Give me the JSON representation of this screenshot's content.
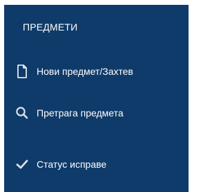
{
  "menu": {
    "section_title": "ПРЕДМЕТИ",
    "items": [
      {
        "label": "Нови предмет/Захтев",
        "icon": "document-icon"
      },
      {
        "label": "Претрага предмета",
        "icon": "search-icon"
      },
      {
        "label": "Статус исправе",
        "icon": "checkmark-icon"
      }
    ]
  },
  "colors": {
    "panel_background": "#0f3b6a",
    "text": "#ffffff",
    "icon_search": "#d9e2ec",
    "icon_check": "#d9e2ec"
  }
}
